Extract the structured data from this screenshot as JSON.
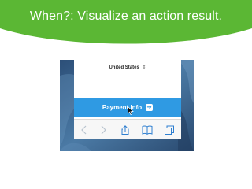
{
  "slide": {
    "title": "When?: Visualize an action result.",
    "banner_color": "#5bb734"
  },
  "screenshot": {
    "country": {
      "value": "United States",
      "caret": "⌃⌄"
    },
    "payment_button": {
      "label": "Payment Info",
      "icon": "arrow-right-icon",
      "color": "#2f9ae3"
    },
    "toolbar": {
      "items": [
        "back-icon",
        "forward-icon",
        "share-icon",
        "bookmarks-icon",
        "tabs-icon"
      ]
    }
  }
}
